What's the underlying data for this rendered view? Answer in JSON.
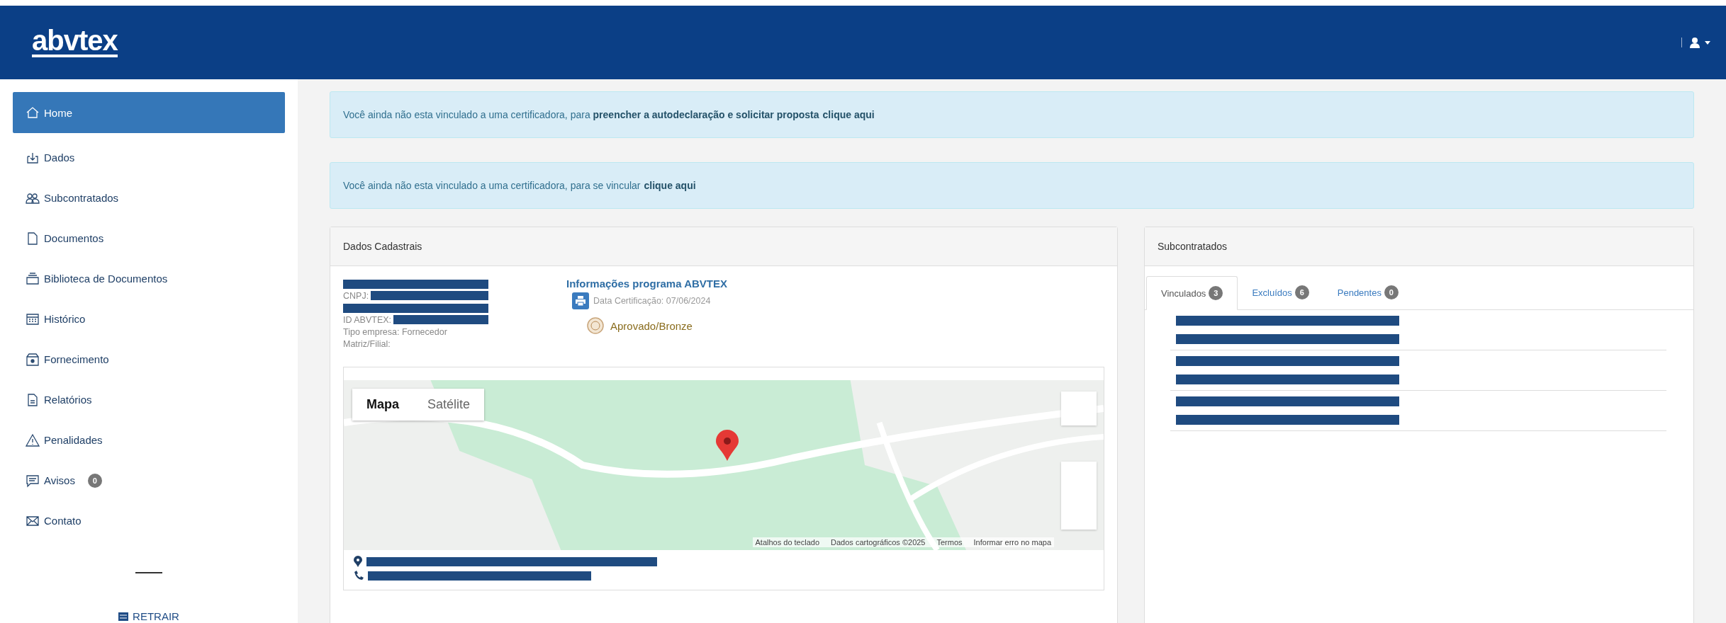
{
  "header": {
    "logo": "abvtex"
  },
  "sidebar": {
    "items": [
      {
        "label": "Home",
        "selected": true
      },
      {
        "label": "Dados",
        "selected": false
      },
      {
        "label": "Subcontratados",
        "selected": false
      },
      {
        "label": "Documentos",
        "selected": false
      },
      {
        "label": "Biblioteca de Documentos",
        "selected": false
      },
      {
        "label": "Histórico",
        "selected": false
      },
      {
        "label": "Fornecimento",
        "selected": false
      },
      {
        "label": "Relatórios",
        "selected": false
      },
      {
        "label": "Penalidades",
        "selected": false
      },
      {
        "label": "Avisos",
        "selected": false,
        "badge": "0"
      },
      {
        "label": "Contato",
        "selected": false
      }
    ],
    "collapse": "RETRAIR"
  },
  "alerts": [
    {
      "text": "Você ainda não esta vinculado a uma certificadora, para **preencher a autodeclaração e solicitar proposta**",
      "link": "clique aqui"
    },
    {
      "text": "Você ainda não esta vinculado a uma certificadora, para se vincular",
      "link": "clique aqui"
    }
  ],
  "dados_cadastrais": {
    "title": "Dados Cadastrais",
    "lines": [
      {
        "kind": "redacted"
      },
      {
        "kind": "field",
        "text": "CNPJ:",
        "redacted": true
      },
      {
        "kind": "redacted"
      },
      {
        "kind": "field",
        "text": "ID ABVTEX:",
        "redacted": true
      },
      {
        "kind": "field",
        "text": "Tipo empresa: Fornecedor",
        "redacted": false
      },
      {
        "kind": "field",
        "text": "Matriz/Filial:",
        "redacted": false
      }
    ],
    "program": {
      "title": "Informações programa ABVTEX",
      "certification": "Data Certificação: 07/06/2024",
      "status": "Aprovado/Bronze"
    },
    "map": {
      "types": [
        {
          "label": "Mapa",
          "selected": true
        },
        {
          "label": "Satélite",
          "selected": false
        }
      ],
      "attribution": [
        "Atalhos do teclado",
        "Dados cartográficos ©2025",
        "Termos",
        "Informar erro no mapa"
      ]
    },
    "contacts": [
      {
        "kind": "address",
        "redacted": true
      },
      {
        "kind": "phone",
        "redacted": true
      }
    ]
  },
  "subcontratados": {
    "title": "Subcontratados",
    "tabs": [
      {
        "label": "Vinculados",
        "count": "3",
        "selected": true
      },
      {
        "label": "Excluídos",
        "count": "6",
        "selected": false
      },
      {
        "label": "Pendentes",
        "count": "0",
        "selected": false
      }
    ],
    "rows": [
      {
        "redacted": true
      },
      {
        "redacted": true
      },
      {
        "redacted": true
      }
    ]
  }
}
